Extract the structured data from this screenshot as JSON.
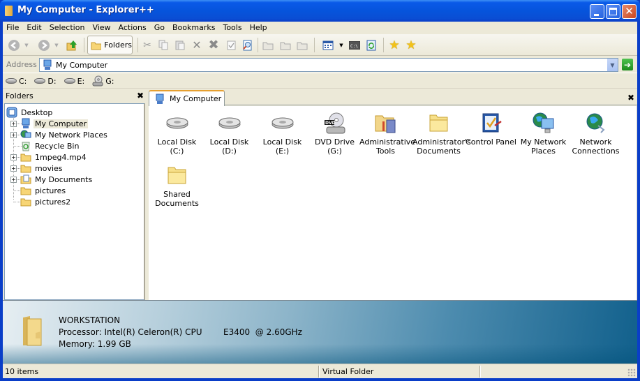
{
  "window": {
    "title": "My Computer - Explorer++",
    "controls": {
      "minimize": "minimize",
      "maximize": "maximize",
      "close": "close"
    }
  },
  "menubar": {
    "items": [
      "File",
      "Edit",
      "Selection",
      "View",
      "Actions",
      "Go",
      "Bookmarks",
      "Tools",
      "Help"
    ]
  },
  "toolbar": {
    "folders_label": "Folders",
    "buttons": [
      "back-icon",
      "forward-icon",
      "up-icon",
      "folders-icon",
      "cut-icon",
      "copy-icon",
      "paste-icon",
      "delete-icon",
      "delete-permanently-icon",
      "properties-icon",
      "search-icon",
      "new-folder-icon",
      "copy-to-icon",
      "move-to-icon",
      "views-icon",
      "command-prompt-icon",
      "refresh-icon",
      "add-bookmark-icon",
      "bookmarks-icon"
    ]
  },
  "address": {
    "label": "Address",
    "value": "My Computer"
  },
  "drives": [
    {
      "label": "C:",
      "icon": "hard-drive-icon"
    },
    {
      "label": "D:",
      "icon": "hard-drive-icon"
    },
    {
      "label": "E:",
      "icon": "hard-drive-icon"
    },
    {
      "label": "G:",
      "icon": "dvd-drive-icon"
    }
  ],
  "folders_pane": {
    "title": "Folders",
    "tree": [
      {
        "label": "Desktop",
        "icon": "desktop-icon",
        "level": 0,
        "expander": false
      },
      {
        "label": "My Computer",
        "icon": "computer-icon",
        "level": 1,
        "expander": true,
        "selected": true
      },
      {
        "label": "My Network Places",
        "icon": "network-places-icon",
        "level": 1,
        "expander": true
      },
      {
        "label": "Recycle Bin",
        "icon": "recycle-bin-icon",
        "level": 1,
        "expander": false
      },
      {
        "label": "1mpeg4.mp4",
        "icon": "folder-icon",
        "level": 1,
        "expander": true
      },
      {
        "label": "movies",
        "icon": "folder-icon",
        "level": 1,
        "expander": true
      },
      {
        "label": "My Documents",
        "icon": "my-documents-icon",
        "level": 1,
        "expander": true
      },
      {
        "label": "pictures",
        "icon": "folder-icon",
        "level": 1,
        "expander": false
      },
      {
        "label": "pictures2",
        "icon": "folder-icon",
        "level": 1,
        "expander": false
      }
    ]
  },
  "tabs": [
    {
      "label": "My Computer",
      "active": true
    }
  ],
  "items": [
    {
      "label": "Local Disk (C:)",
      "icon": "hard-drive-icon"
    },
    {
      "label": "Local Disk (D:)",
      "icon": "hard-drive-icon"
    },
    {
      "label": "Local Disk (E:)",
      "icon": "hard-drive-icon"
    },
    {
      "label": "DVD Drive (G:)",
      "icon": "dvd-drive-icon"
    },
    {
      "label": "Administrative Tools",
      "icon": "admin-tools-icon"
    },
    {
      "label": "Administrator's Documents",
      "icon": "folder-icon"
    },
    {
      "label": "Control Panel",
      "icon": "control-panel-icon"
    },
    {
      "label": "My Network Places",
      "icon": "network-places-icon"
    },
    {
      "label": "Network Connections",
      "icon": "network-connections-icon"
    },
    {
      "label": "Shared Documents",
      "icon": "folder-icon"
    }
  ],
  "info_pane": {
    "name": "WORKSTATION",
    "processor": "Processor: Intel(R) Celeron(R) CPU        E3400  @ 2.60GHz",
    "memory": "Memory: 1.99 GB"
  },
  "statusbar": {
    "count": "10 items",
    "type": "Virtual Folder",
    "extra": ""
  },
  "colors": {
    "titlebar": "#0654dc",
    "client": "#ece9d8",
    "tab_accent": "#e6a030",
    "infopane_dark": "#11608c"
  }
}
